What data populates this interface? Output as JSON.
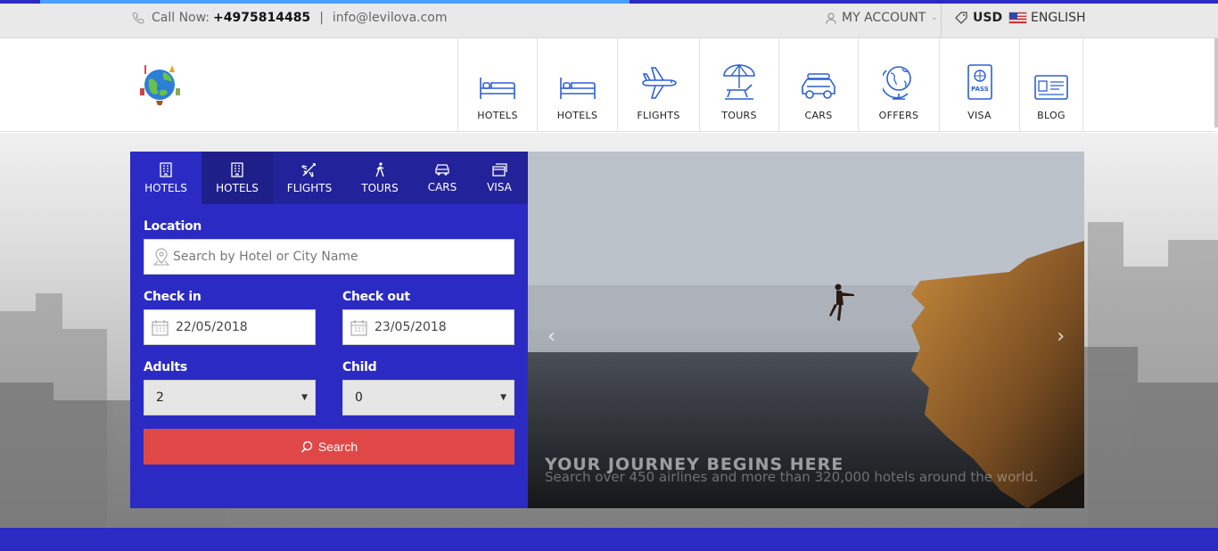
{
  "topbar": {
    "call_label": "Call Now:",
    "phone": "+4975814485",
    "separator": "|",
    "email": "info@levilova.com",
    "account_label": "MY ACCOUNT",
    "currency": "USD",
    "language": "ENGLISH"
  },
  "page_progress": 0.5,
  "nav": {
    "items": [
      {
        "label": "HOTELS",
        "icon": "bed-icon"
      },
      {
        "label": "HOTELS",
        "icon": "bed-icon"
      },
      {
        "label": "FLIGHTS",
        "icon": "airplane-icon"
      },
      {
        "label": "TOURS",
        "icon": "beach-umbrella-icon"
      },
      {
        "label": "CARS",
        "icon": "car-icon"
      },
      {
        "label": "OFFERS",
        "icon": "globe-icon"
      },
      {
        "label": "VISA",
        "icon": "passport-icon"
      },
      {
        "label": "BLOG",
        "icon": "id-card-icon"
      }
    ]
  },
  "search": {
    "tabs": [
      {
        "label": "HOTELS",
        "icon": "building-icon"
      },
      {
        "label": "HOTELS",
        "icon": "building-icon"
      },
      {
        "label": "FLIGHTS",
        "icon": "airplane-icon"
      },
      {
        "label": "TOURS",
        "icon": "hiker-icon"
      },
      {
        "label": "CARS",
        "icon": "car-icon"
      },
      {
        "label": "VISA",
        "icon": "card-icon"
      }
    ],
    "location_label": "Location",
    "location_placeholder": "Search by Hotel or City Name",
    "checkin_label": "Check in",
    "checkin_value": "22/05/2018",
    "checkout_label": "Check out",
    "checkout_value": "23/05/2018",
    "adults_label": "Adults",
    "adults_value": "2",
    "child_label": "Child",
    "child_value": "0",
    "search_button": "Search"
  },
  "slider": {
    "title": "YOUR JOURNEY BEGINS HERE",
    "subtitle": "Search over 450 airlines and more than 320,000 hotels around the world.",
    "prev": "‹",
    "next": "›"
  },
  "colors": {
    "primary": "#2b2bc4",
    "tab_bar": "#22229a",
    "search_button": "#e04848",
    "icon_blue": "#2b5fd6"
  }
}
